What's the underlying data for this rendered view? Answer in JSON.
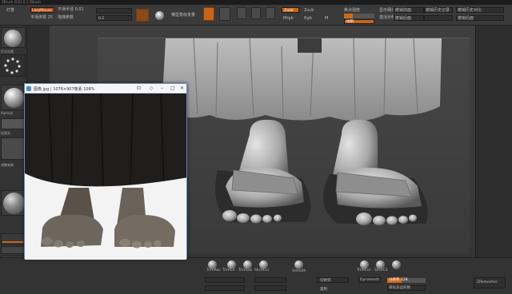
{
  "titlebar": {
    "text": "ZBrush 2022.0.1 ZBrush"
  },
  "toolbar": {
    "project_field": "LazyMouse",
    "row1_label_a": "平滑半径 0.01",
    "row1_label_b": "平滑步数 25",
    "row2_label_a": "拖拽参数",
    "row2_label_b": "0.2",
    "button_label": "Edit",
    "mode_label": "横型角标变量",
    "zadd_label": "Zadd",
    "zsub_label": "Zsub",
    "mrgb_label": "Mrgb",
    "rgb_label": "Rgb",
    "m_label": "M",
    "focal_label": "焦点强度",
    "draw_label": "绘制",
    "right_a": "显示细分",
    "right_b": "激活对称",
    "right_c": "撤销前面",
    "right_d": "撤销后面",
    "right_e": "撤销历史记录",
    "right_f": "撤销历史对比",
    "right_g": "撤销后面"
  },
  "leftcol": {
    "labels": [
      "灯光设置",
      "笔刷",
      "Alpha关",
      "纹理关",
      "材质",
      "调整笔刷",
      "渐变",
      "切换"
    ]
  },
  "refwindow": {
    "title": "图像.jpg | 1076×907像素 108%"
  },
  "bottom": {
    "labels": [
      "TrimRec",
      "TrimCir",
      "TrimLas",
      "SliceCur",
      "Smooth",
      "TrimCur",
      "SliceCir",
      "ZRemesher",
      "Dynamesh",
      "切换到",
      "分辨率 128",
      "目标多边形数",
      "调整大小",
      "修复",
      "复制"
    ]
  }
}
